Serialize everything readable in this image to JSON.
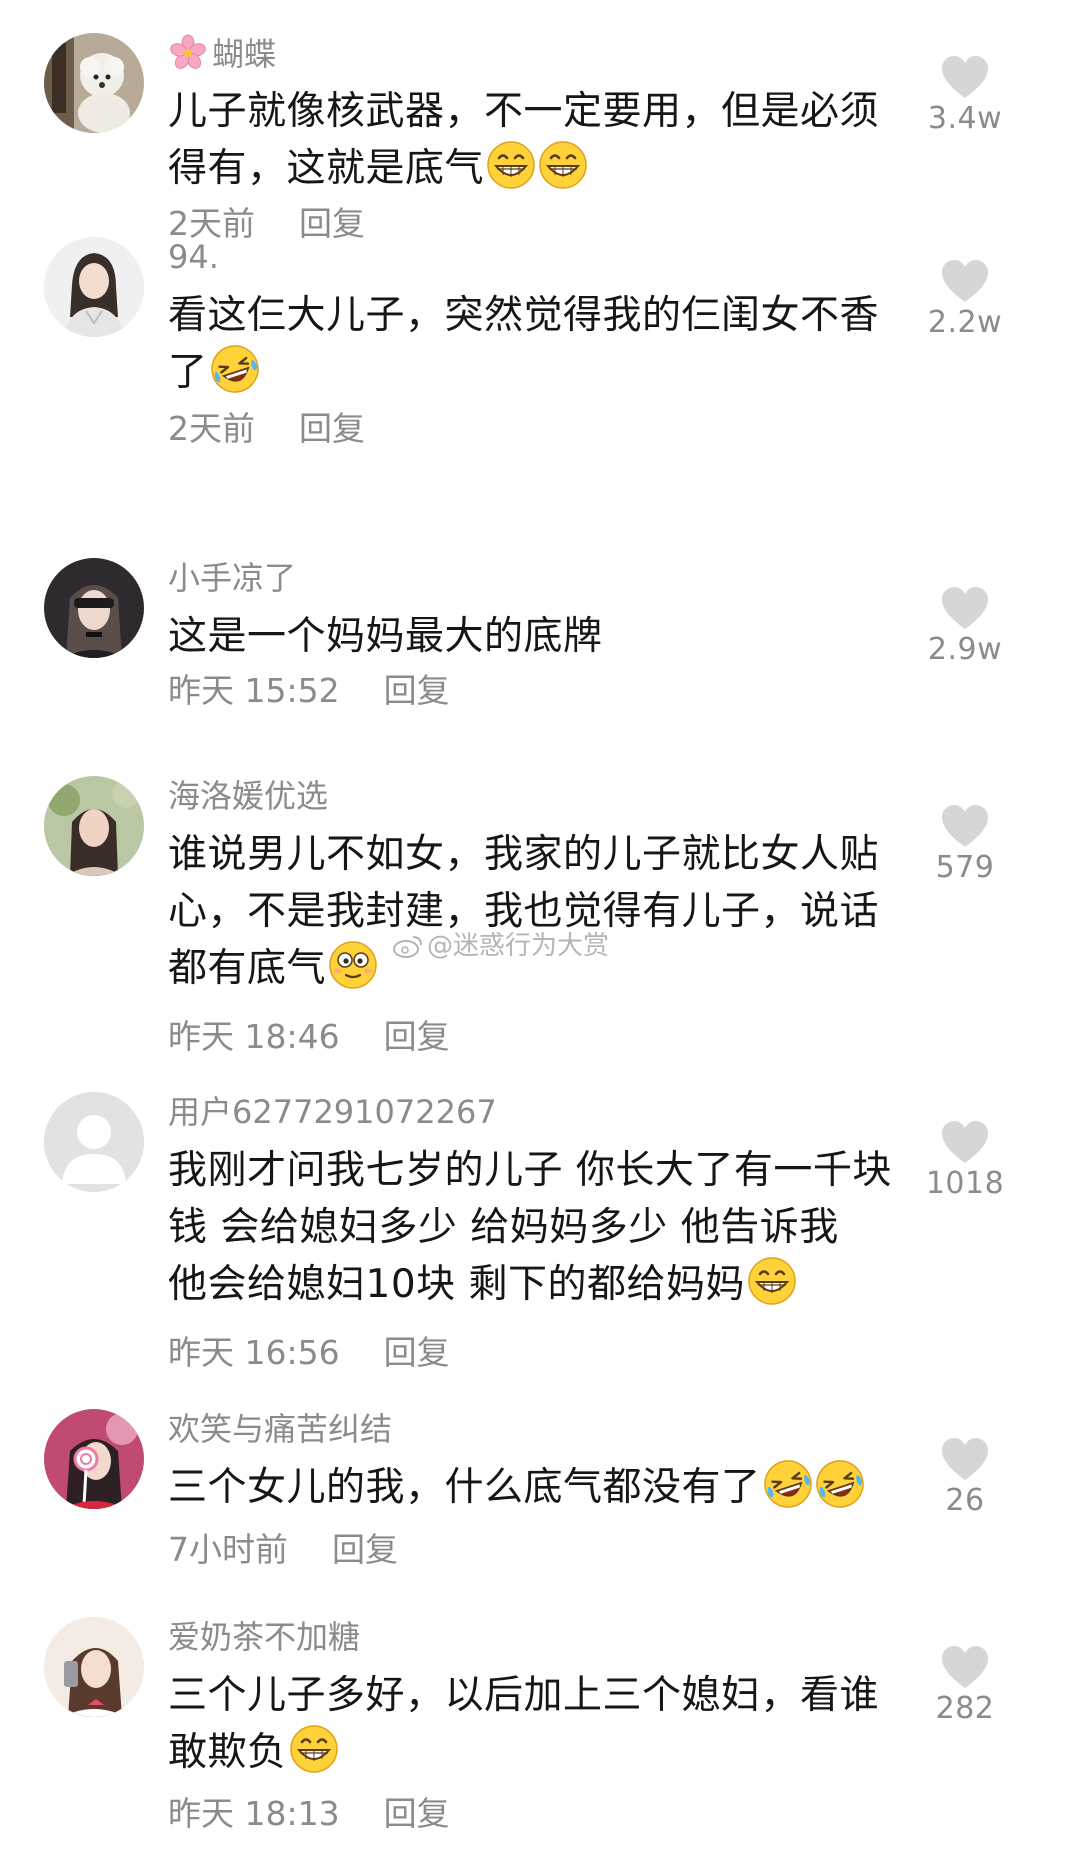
{
  "comments": [
    {
      "username": "蝴蝶",
      "lines": [
        "儿子就像核武器，不一定要用，但是必须",
        "得有，这就是底气"
      ],
      "time": "2天前",
      "reply": "回复",
      "likes": "3.4w"
    },
    {
      "username": "94.",
      "lines": [
        "看这仨大儿子，突然觉得我的仨闺女不香",
        "了"
      ],
      "time": "2天前",
      "reply": "回复",
      "likes": "2.2w"
    },
    {
      "username": "小手凉了",
      "lines": [
        "这是一个妈妈最大的底牌"
      ],
      "time": "昨天 15:52",
      "reply": "回复",
      "likes": "2.9w"
    },
    {
      "username": "海洛媛优选",
      "lines": [
        "谁说男儿不如女，我家的儿子就比女人贴",
        "心，不是我封建，我也觉得有儿子，说话",
        "都有底气"
      ],
      "time": "昨天 18:46",
      "reply": "回复",
      "likes": "579"
    },
    {
      "username": "用户6277291072267",
      "lines": [
        "我刚才问我七岁的儿子 你长大了有一千块",
        "钱 会给媳妇多少  给妈妈多少  他告诉我",
        "他会给媳妇10块  剩下的都给妈妈"
      ],
      "time": "昨天 16:56",
      "reply": "回复",
      "likes": "1018"
    },
    {
      "username": "欢笑与痛苦纠结",
      "lines": [
        "三个女儿的我，什么底气都没有了"
      ],
      "time": "7小时前",
      "reply": "回复",
      "likes": "26"
    },
    {
      "username": "爱奶茶不加糖",
      "lines": [
        "三个儿子多好，以后加上三个媳妇，看谁",
        "敢欺负"
      ],
      "time": "昨天 18:13",
      "reply": "回复",
      "likes": "282"
    }
  ],
  "watermark": "@迷惑行为大赏",
  "icons": {
    "like": "heart-icon",
    "flower": "cherry-blossom-icon",
    "grin": "grinning-face-emoji",
    "laugh": "tears-of-joy-emoji",
    "dizzy": "dizzy-eyes-emoji"
  },
  "colors": {
    "text": "#161616",
    "muted": "#8b8b8b",
    "heart": "#d4d4d4"
  }
}
